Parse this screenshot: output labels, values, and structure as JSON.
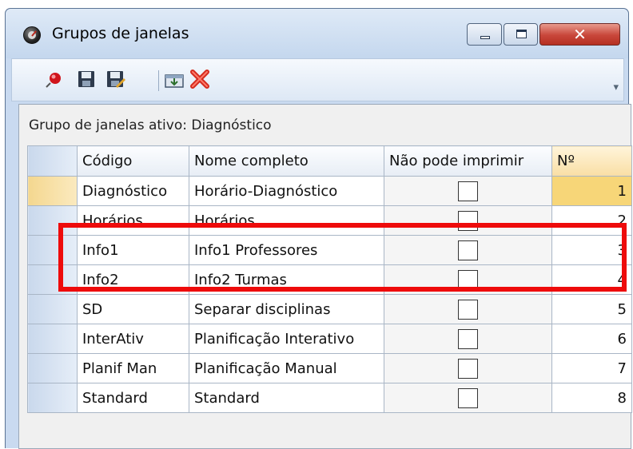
{
  "window": {
    "title": "Grupos de janelas",
    "close_symbol": "✕"
  },
  "toolbar": {
    "icons": [
      "pin-icon",
      "save-icon",
      "save-as-icon",
      "import-icon",
      "delete-icon"
    ],
    "grip_symbol": "▾"
  },
  "subtitle": "Grupo de janelas ativo: Diagnóstico",
  "table": {
    "headers": {
      "code": "Código",
      "name": "Nome completo",
      "no_print": "Não pode imprimir",
      "number": "Nº"
    },
    "rows": [
      {
        "code": "Diagnóstico",
        "name": "Horário-Diagnóstico",
        "no_print": false,
        "number": "1"
      },
      {
        "code": "Horários",
        "name": "Horários",
        "no_print": false,
        "number": "2"
      },
      {
        "code": "Info1",
        "name": "Info1 Professores",
        "no_print": false,
        "number": "3"
      },
      {
        "code": "Info2",
        "name": "Info2 Turmas",
        "no_print": false,
        "number": "4"
      },
      {
        "code": "SD",
        "name": "Separar disciplinas",
        "no_print": false,
        "number": "5"
      },
      {
        "code": "InterAtiv",
        "name": "Planificação Interativo",
        "no_print": false,
        "number": "6"
      },
      {
        "code": "Planif Man",
        "name": "Planificação Manual",
        "no_print": false,
        "number": "7"
      },
      {
        "code": "Standard",
        "name": "Standard",
        "no_print": false,
        "number": "8"
      }
    ]
  },
  "colors": {
    "highlight": "#ee0b0b",
    "active_cell": "#f7d678",
    "close_button": "#c8463a"
  }
}
